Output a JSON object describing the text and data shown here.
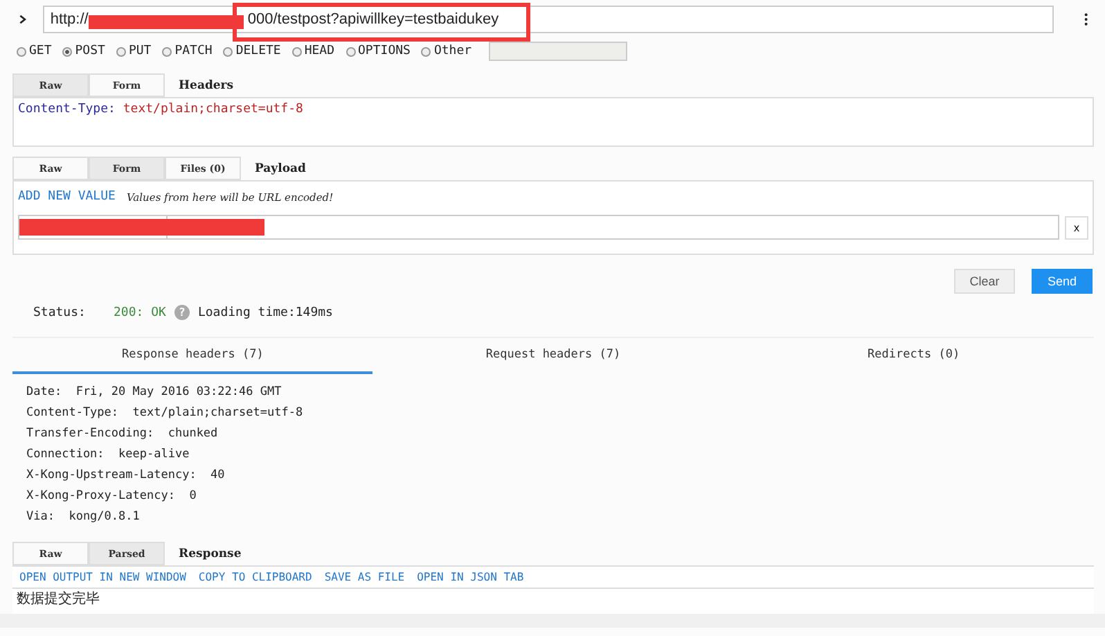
{
  "url_bar": {
    "prefix": "http://",
    "suffix": "000/testpost?apiwillkey=testbaidukey",
    "redacted": true,
    "highlighted": true
  },
  "methods": [
    {
      "label": "GET",
      "selected": false
    },
    {
      "label": "POST",
      "selected": true
    },
    {
      "label": "PUT",
      "selected": false
    },
    {
      "label": "PATCH",
      "selected": false
    },
    {
      "label": "DELETE",
      "selected": false
    },
    {
      "label": "HEAD",
      "selected": false
    },
    {
      "label": "OPTIONS",
      "selected": false
    },
    {
      "label": "Other",
      "selected": false
    }
  ],
  "headers": {
    "tabs": [
      {
        "label": "Raw",
        "selected": true
      },
      {
        "label": "Form",
        "selected": false
      }
    ],
    "title": "Headers",
    "key": "Content-Type:",
    "value": "text/plain;charset=utf-8"
  },
  "payload": {
    "tabs": [
      {
        "label": "Raw",
        "selected": false
      },
      {
        "label": "Form",
        "selected": true
      },
      {
        "label": "Files (0)",
        "selected": false
      }
    ],
    "title": "Payload",
    "add_link": "ADD NEW VALUE",
    "hint": "Values from here will be URL encoded!",
    "row_redacted": true,
    "remove": "x"
  },
  "actions": [
    "Clear",
    "Send"
  ],
  "status": {
    "label": "Status:",
    "code": "200: OK",
    "help": "?",
    "loading": "Loading time:149ms"
  },
  "response_tabs": [
    {
      "label": "Response headers (7)",
      "selected": true
    },
    {
      "label": "Request headers (7)",
      "selected": false
    },
    {
      "label": "Redirects (0)",
      "selected": false
    }
  ],
  "response_headers": [
    {
      "name": "Date:",
      "value": "Fri, 20 May 2016 03:22:46 GMT"
    },
    {
      "name": "Content-Type:",
      "value": "text/plain;charset=utf-8"
    },
    {
      "name": "Transfer-Encoding:",
      "value": "chunked"
    },
    {
      "name": "Connection:",
      "value": "keep-alive"
    },
    {
      "name": "X-Kong-Upstream-Latency:",
      "value": "40"
    },
    {
      "name": "X-Kong-Proxy-Latency:",
      "value": "0"
    },
    {
      "name": "Via:",
      "value": "kong/0.8.1"
    }
  ],
  "response": {
    "tabs": [
      {
        "label": "Raw",
        "selected": false
      },
      {
        "label": "Parsed",
        "selected": true
      }
    ],
    "title": "Response",
    "links": [
      "OPEN OUTPUT IN NEW WINDOW",
      "COPY TO CLIPBOARD",
      "SAVE AS FILE",
      "OPEN IN JSON TAB"
    ],
    "body": "数据提交完毕"
  }
}
